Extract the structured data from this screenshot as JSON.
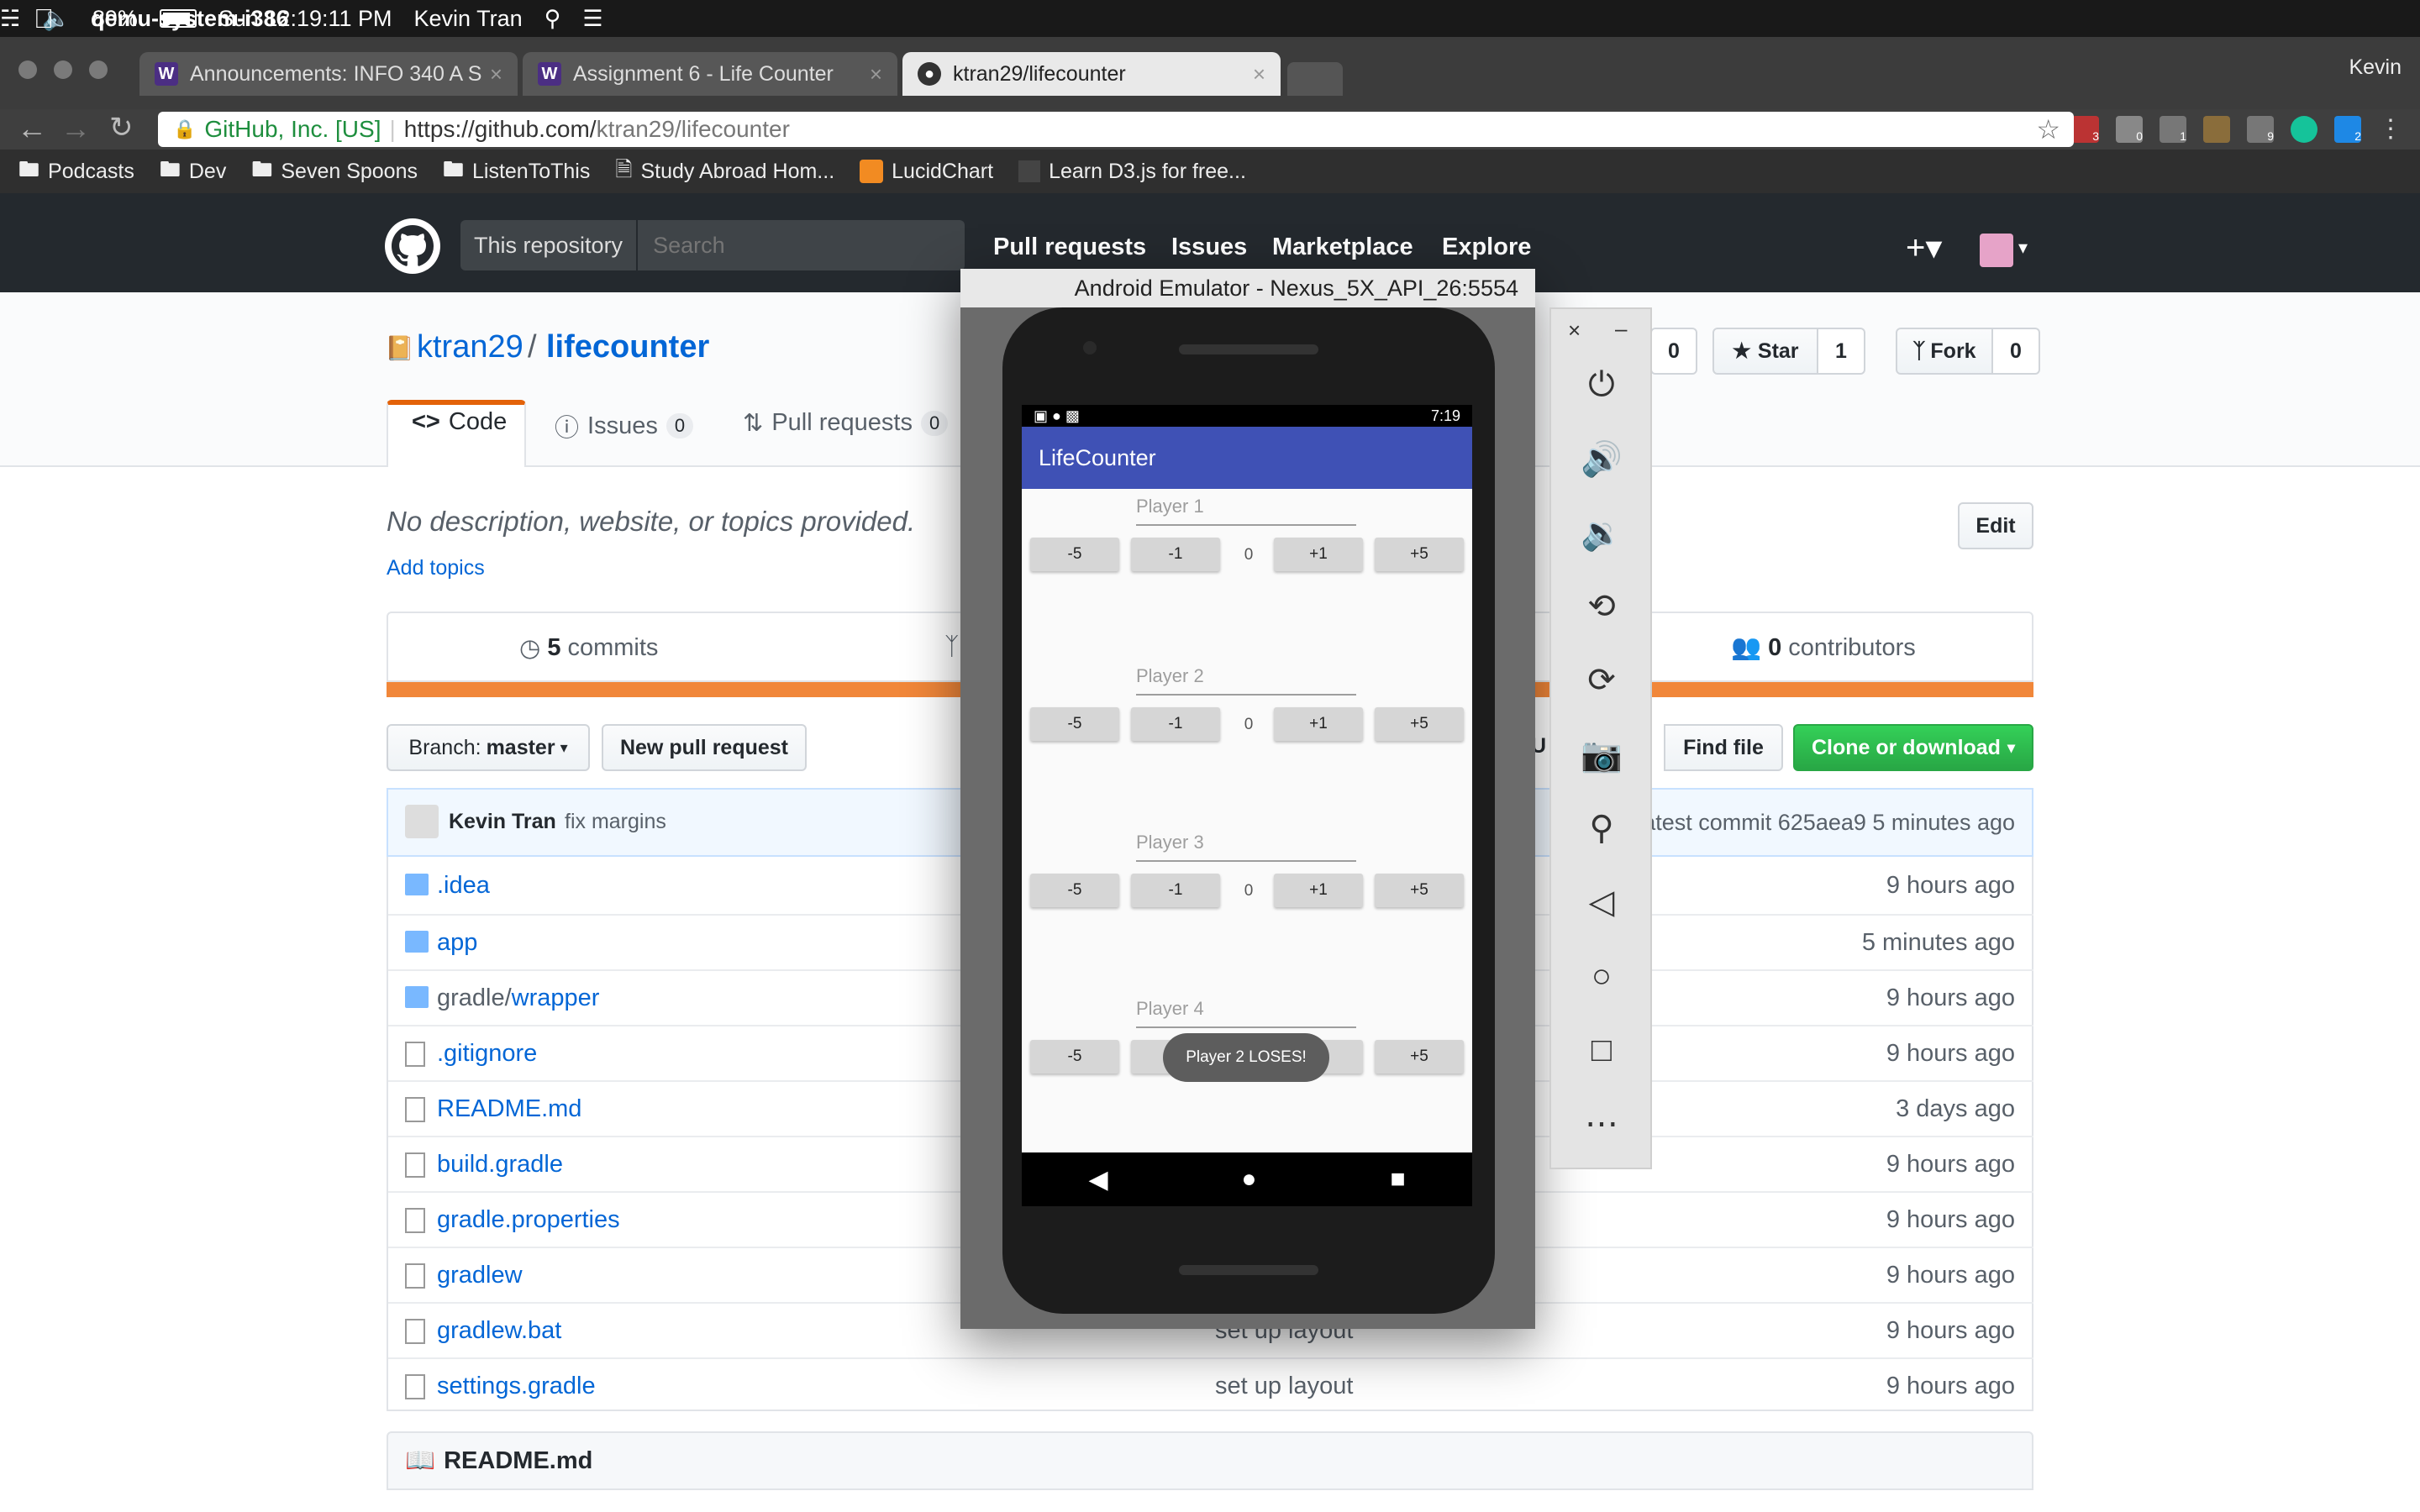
{
  "menubar": {
    "app_name": "qemu-system-i386",
    "battery": "89%",
    "datetime": "Sun 12:19:11 PM",
    "user": "Kevin Tran"
  },
  "browser": {
    "tabs": [
      {
        "label": "Announcements: INFO 340 A S",
        "icon": "W"
      },
      {
        "label": "Assignment 6 - Life Counter",
        "icon": "W"
      },
      {
        "label": "ktran29/lifecounter",
        "icon": "github-icon"
      }
    ],
    "profile": "Kevin",
    "security_label": "GitHub, Inc. [US]",
    "url_prefix": "https://github.com/",
    "url_rest": "ktran29/lifecounter",
    "bookmarks": [
      "Podcasts",
      "Dev",
      "Seven Spoons",
      "ListenToThis",
      "Study Abroad Hom...",
      "LucidChart",
      "Learn D3.js for free..."
    ],
    "extension_badges": [
      "3",
      "0",
      "1",
      "",
      "9",
      "",
      "2"
    ]
  },
  "github": {
    "scope_label": "This repository",
    "search_placeholder": "Search",
    "nav": [
      "Pull requests",
      "Issues",
      "Marketplace",
      "Explore"
    ],
    "owner": "ktran29",
    "separator": "/",
    "repo": "lifecounter",
    "watch_count": "0",
    "star_label": "Star",
    "star_count": "1",
    "fork_label": "Fork",
    "fork_count": "0",
    "tabs": {
      "code": "Code",
      "issues": "Issues",
      "issues_count": "0",
      "pulls": "Pull requests",
      "pulls_count": "0"
    },
    "description": "No description, website, or topics provided.",
    "add_topics": "Add topics",
    "edit_label": "Edit",
    "commits_count": "5",
    "commits_label": "commits",
    "contributors_count": "0",
    "contributors_label": "contributors",
    "branch_label": "Branch:",
    "branch_name": "master",
    "new_pr_label": "New pull request",
    "upload_fragment": "U",
    "find_file_label": "Find file",
    "clone_label": "Clone or download",
    "commit_author": "Kevin Tran",
    "commit_message": "fix margins",
    "latest_commit": "atest commit 625aea9 5 minutes ago",
    "files": [
      {
        "name": ".idea",
        "type": "dir",
        "msg": "",
        "age": "9 hours ago"
      },
      {
        "name": "app",
        "type": "dir",
        "msg": "",
        "age": "5 minutes ago"
      },
      {
        "name": "gradle/",
        "name_link": "wrapper",
        "type": "dir",
        "msg": "",
        "age": "9 hours ago"
      },
      {
        "name": ".gitignore",
        "type": "file",
        "msg": "",
        "age": "9 hours ago"
      },
      {
        "name": "README.md",
        "type": "file",
        "msg": "",
        "age": "3 days ago"
      },
      {
        "name": "build.gradle",
        "type": "file",
        "msg": "",
        "age": "9 hours ago"
      },
      {
        "name": "gradle.properties",
        "type": "file",
        "msg": "",
        "age": "9 hours ago"
      },
      {
        "name": "gradlew",
        "type": "file",
        "msg": "",
        "age": "9 hours ago"
      },
      {
        "name": "gradlew.bat",
        "type": "file",
        "msg": "set up layout",
        "age": "9 hours ago"
      },
      {
        "name": "settings.gradle",
        "type": "file",
        "msg": "set up layout",
        "age": "9 hours ago"
      }
    ],
    "readme_title": "README.md"
  },
  "emulator": {
    "title": "Android Emulator - Nexus_5X_API_26:5554",
    "clock": "7:19",
    "app_title": "LifeCounter",
    "players": [
      {
        "label": "Player 1",
        "score": "0"
      },
      {
        "label": "Player 2",
        "score": "0"
      },
      {
        "label": "Player 3",
        "score": "0"
      },
      {
        "label": "Player 4",
        "score": "0"
      }
    ],
    "buttons": [
      "-5",
      "-1",
      "+1",
      "+5"
    ],
    "toast": "Player 2 LOSES!"
  }
}
